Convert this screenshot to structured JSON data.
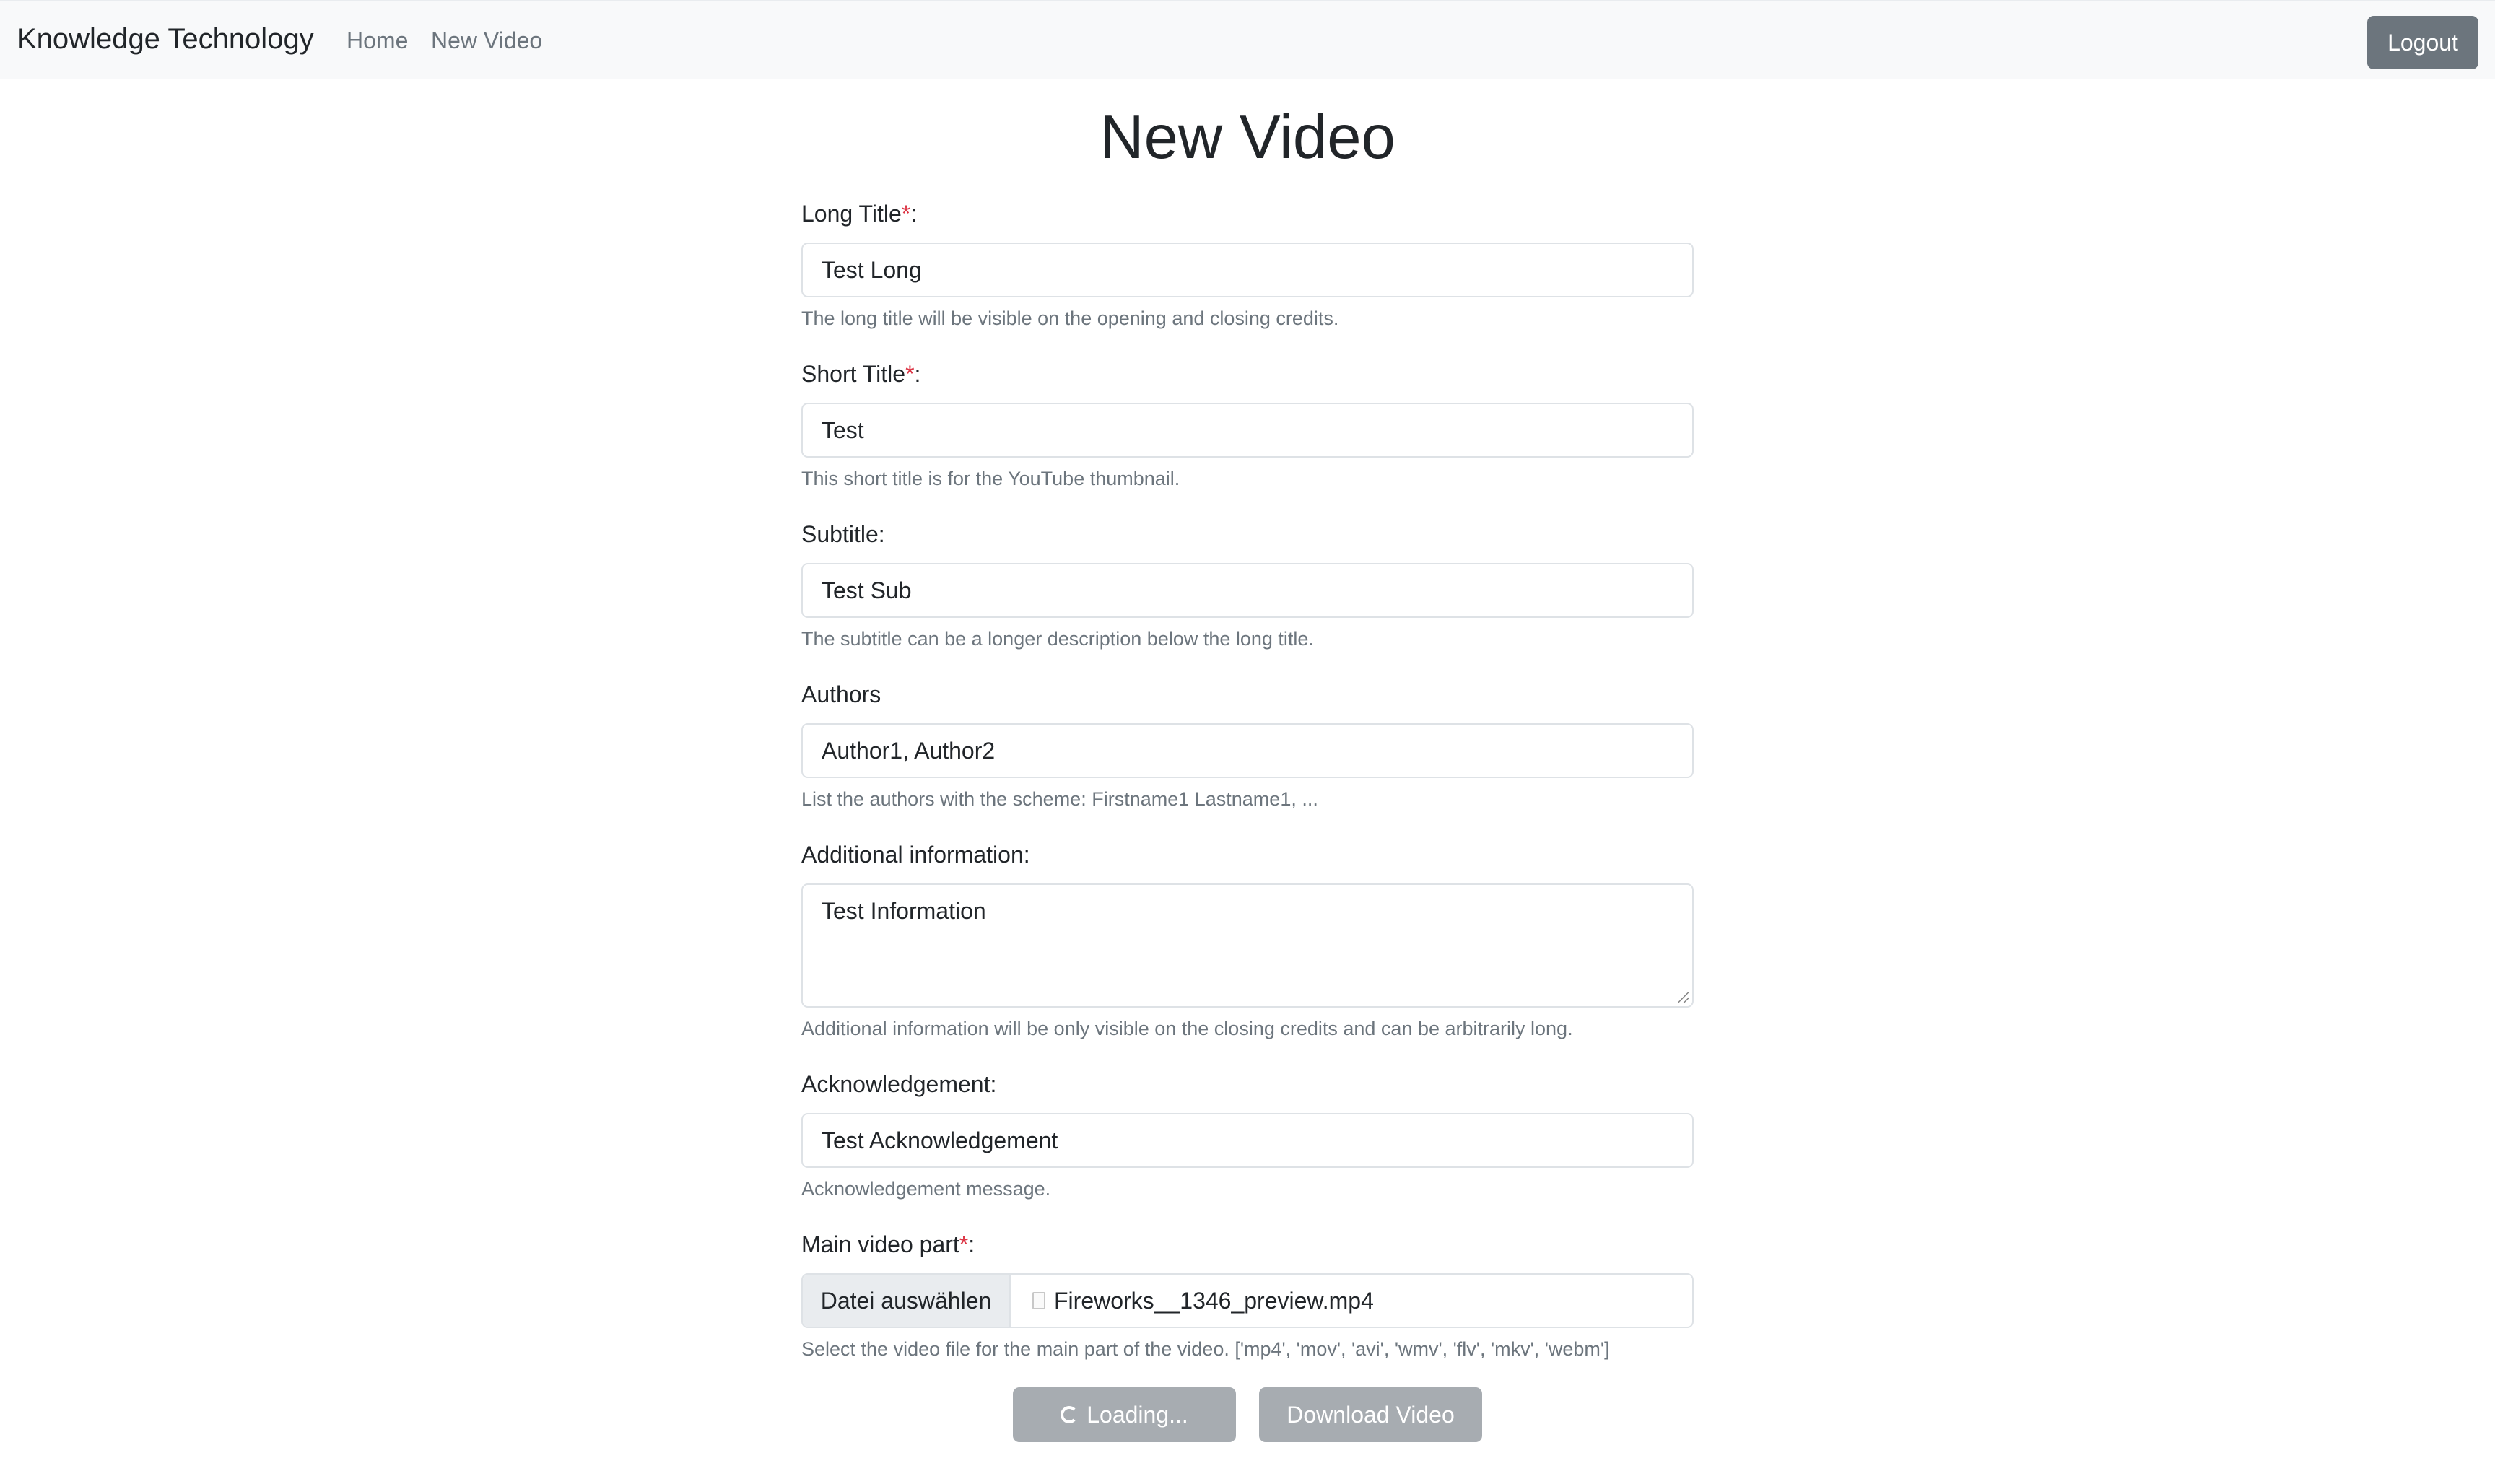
{
  "navbar": {
    "brand": "Knowledge Technology",
    "links": [
      "Home",
      "New Video"
    ],
    "logout_label": "Logout"
  },
  "page": {
    "title": "New Video"
  },
  "form": {
    "long_title": {
      "label": "Long Title",
      "required_mark": "*",
      "suffix": ":",
      "value": "Test Long",
      "help": "The long title will be visible on the opening and closing credits."
    },
    "short_title": {
      "label": "Short Title",
      "required_mark": "*",
      "suffix": ":",
      "value": "Test",
      "help": "This short title is for the YouTube thumbnail."
    },
    "subtitle": {
      "label": "Subtitle:",
      "value": "Test Sub",
      "help": "The subtitle can be a longer description below the long title."
    },
    "authors": {
      "label": "Authors",
      "value": "Author1, Author2",
      "help": "List the authors with the scheme: Firstname1 Lastname1, ..."
    },
    "additional_info": {
      "label": "Additional information:",
      "value": "Test Information",
      "help": "Additional information will be only visible on the closing credits and can be arbitrarily long."
    },
    "acknowledgement": {
      "label": "Acknowledgement:",
      "value": "Test Acknowledgement",
      "help": "Acknowledgement message."
    },
    "main_video": {
      "label": "Main video part",
      "required_mark": "*",
      "suffix": ":",
      "button_label": "Datei auswählen",
      "file_name": "Fireworks__1346_preview.mp4",
      "help": "Select the video file for the main part of the video. ['mp4', 'mov', 'avi', 'wmv', 'flv', 'mkv', 'webm']"
    }
  },
  "actions": {
    "loading_label": "Loading...",
    "download_label": "Download Video"
  }
}
